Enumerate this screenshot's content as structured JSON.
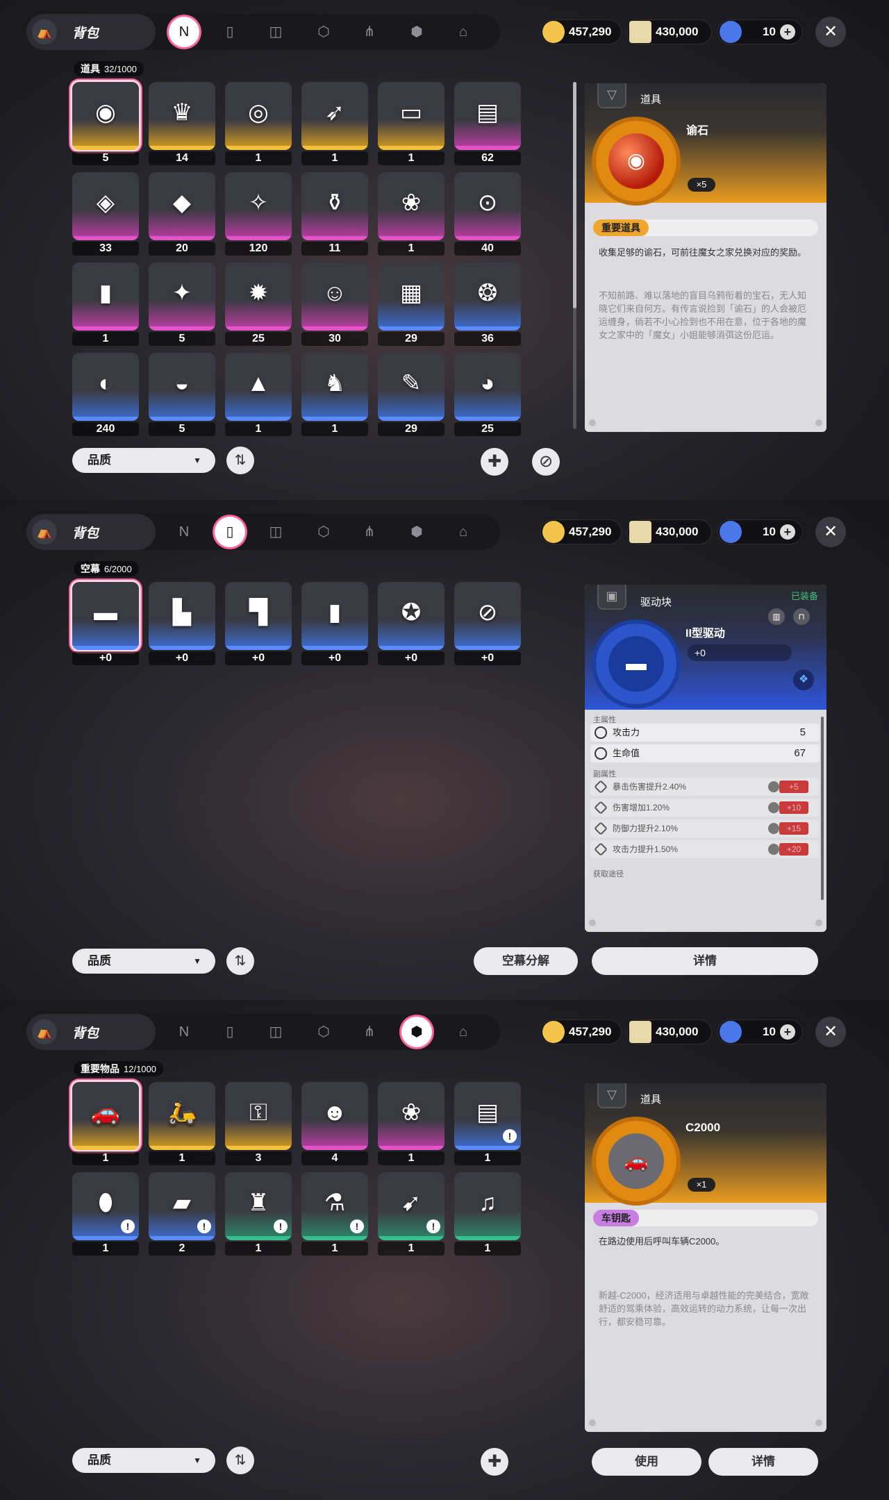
{
  "header": {
    "bag_label": "背包"
  },
  "currency": [
    {
      "value": "457,290",
      "color": "#f3c54a",
      "icon": "gold-coin-icon"
    },
    {
      "value": "430,000",
      "color": "#e8d8a8",
      "icon": "ticket-icon"
    },
    {
      "value": "10",
      "color": "#4a78e8",
      "icon": "crystal-icon"
    }
  ],
  "panel1": {
    "section": {
      "name": "道具",
      "count": "32/1000"
    },
    "items": [
      {
        "count": "5",
        "q": "gold",
        "icon": "◉"
      },
      {
        "count": "14",
        "q": "gold",
        "icon": "♛"
      },
      {
        "count": "1",
        "q": "gold",
        "icon": "◎"
      },
      {
        "count": "1",
        "q": "gold",
        "icon": "➶"
      },
      {
        "count": "1",
        "q": "gold",
        "icon": "▭"
      },
      {
        "count": "62",
        "q": "purple",
        "icon": "▤"
      },
      {
        "count": "33",
        "q": "purple",
        "icon": "◈"
      },
      {
        "count": "20",
        "q": "purple",
        "icon": "◆"
      },
      {
        "count": "120",
        "q": "purple",
        "icon": "✧"
      },
      {
        "count": "11",
        "q": "purple",
        "icon": "⚱"
      },
      {
        "count": "1",
        "q": "purple",
        "icon": "❀"
      },
      {
        "count": "40",
        "q": "purple",
        "icon": "⊙"
      },
      {
        "count": "1",
        "q": "purple",
        "icon": "▮"
      },
      {
        "count": "5",
        "q": "purple",
        "icon": "✦"
      },
      {
        "count": "25",
        "q": "purple",
        "icon": "✹"
      },
      {
        "count": "30",
        "q": "purple",
        "icon": "☺"
      },
      {
        "count": "29",
        "q": "blue",
        "icon": "▦"
      },
      {
        "count": "36",
        "q": "blue",
        "icon": "❂"
      },
      {
        "count": "240",
        "q": "blue",
        "icon": "◐"
      },
      {
        "count": "5",
        "q": "blue",
        "icon": "◒"
      },
      {
        "count": "1",
        "q": "blue",
        "icon": "▲"
      },
      {
        "count": "1",
        "q": "blue",
        "icon": "♞"
      },
      {
        "count": "29",
        "q": "blue",
        "icon": "✎"
      },
      {
        "count": "25",
        "q": "blue",
        "icon": "◕"
      }
    ],
    "detail": {
      "type": "道具",
      "name": "谕石",
      "qty": "×5",
      "tag": "重要道具",
      "desc": "收集足够的谕石，可前往魔女之家兑换对应的奖励。",
      "lore": "不知前路、难以落地的盲目乌鸦衔着的宝石，无人知晓它们来自何方。有传言说捡到「谕石」的人会被厄运缠身，倘若不小心捡到也不用在意，位于各地的魔女之家中的「魔女」小姐能够消弭这份厄运。"
    },
    "filter": "品质"
  },
  "panel2": {
    "section": {
      "name": "空幕",
      "count": "6/2000"
    },
    "items": [
      {
        "count": "+0",
        "q": "blue",
        "icon": "▬"
      },
      {
        "count": "+0",
        "q": "blue",
        "icon": "▙"
      },
      {
        "count": "+0",
        "q": "blue",
        "icon": "▜"
      },
      {
        "count": "+0",
        "q": "blue",
        "icon": "▮"
      },
      {
        "count": "+0",
        "q": "blue",
        "icon": "✪"
      },
      {
        "count": "+0",
        "q": "blue",
        "icon": "⊘"
      }
    ],
    "detail": {
      "type": "驱动块",
      "equipped": "已装备",
      "name": "II型驱动",
      "level": "+0",
      "main_label": "主属性",
      "main": [
        {
          "label": "攻击力",
          "value": "5"
        },
        {
          "label": "生命值",
          "value": "67"
        }
      ],
      "sub_label": "副属性",
      "sub": [
        {
          "label": "暴击伤害提升2.40%",
          "plus": "+5"
        },
        {
          "label": "伤害增加1.20%",
          "plus": "+10"
        },
        {
          "label": "防御力提升2.10%",
          "plus": "+15"
        },
        {
          "label": "攻击力提升1.50%",
          "plus": "+20"
        }
      ],
      "source_label": "获取途径"
    },
    "filter": "品质",
    "btn_decompose": "空幕分解",
    "btn_detail": "详情"
  },
  "panel3": {
    "section": {
      "name": "重要物品",
      "count": "12/1000"
    },
    "items": [
      {
        "count": "1",
        "q": "gold",
        "icon": "🚗",
        "warn": false
      },
      {
        "count": "1",
        "q": "gold",
        "icon": "🛵",
        "warn": false
      },
      {
        "count": "3",
        "q": "gold",
        "icon": "⚿",
        "warn": false
      },
      {
        "count": "4",
        "q": "purple",
        "icon": "☻",
        "warn": false
      },
      {
        "count": "1",
        "q": "purple",
        "icon": "❀",
        "warn": false
      },
      {
        "count": "1",
        "q": "blue",
        "icon": "▤",
        "warn": true
      },
      {
        "count": "1",
        "q": "blue",
        "icon": "⬮",
        "warn": true
      },
      {
        "count": "2",
        "q": "blue",
        "icon": "▰",
        "warn": true
      },
      {
        "count": "1",
        "q": "green",
        "icon": "♜",
        "warn": true
      },
      {
        "count": "1",
        "q": "green",
        "icon": "⚗",
        "warn": true
      },
      {
        "count": "1",
        "q": "green",
        "icon": "➹",
        "warn": true
      },
      {
        "count": "1",
        "q": "green",
        "icon": "♫",
        "warn": false
      }
    ],
    "detail": {
      "type": "道具",
      "name": "C2000",
      "qty": "×1",
      "tag": "车钥匙",
      "desc": "在路边使用后呼叫车辆C2000。",
      "lore": "新越-C2000，经济适用与卓越性能的完美结合，宽敞舒适的驾乘体验，高效运转的动力系统，让每一次出行，都安稳可靠。"
    },
    "filter": "品质",
    "btn_use": "使用",
    "btn_detail": "详情"
  }
}
